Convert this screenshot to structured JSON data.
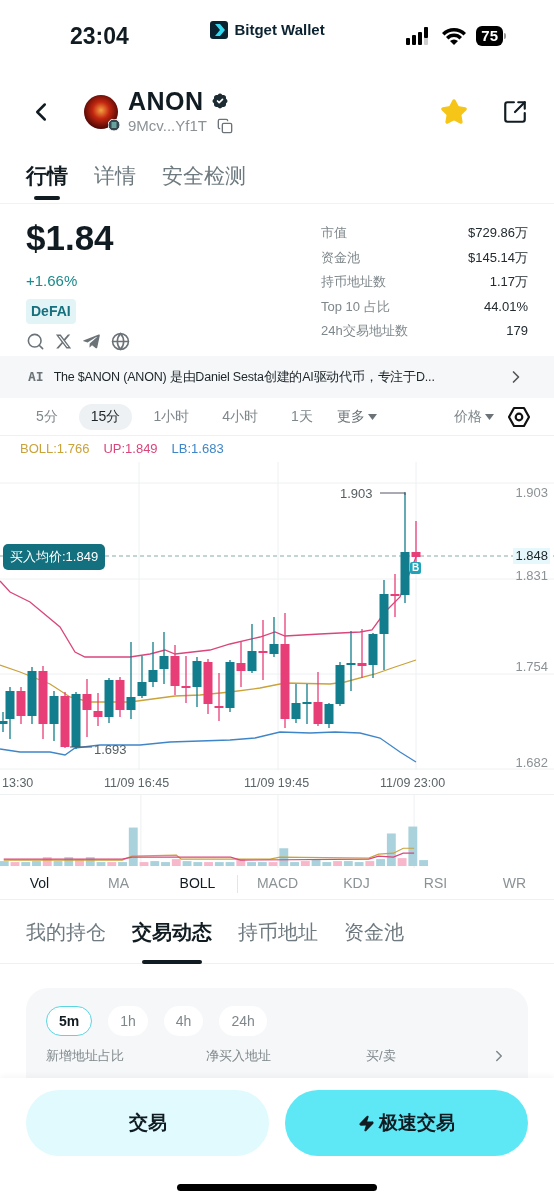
{
  "status_bar": {
    "time": "23:04",
    "app_name": "Bitget Wallet",
    "battery": "75"
  },
  "token": {
    "symbol": "ANON",
    "verified": true,
    "address": "9Mcv...Yf1T",
    "favorited": true
  },
  "page_tabs": [
    {
      "label": "行情",
      "selected": true
    },
    {
      "label": "详情",
      "selected": false
    },
    {
      "label": "安全检测",
      "selected": false
    }
  ],
  "price": {
    "value": "$1.84",
    "change": "+1.66%",
    "tag": "DeFAI"
  },
  "stats": [
    {
      "label": "市值",
      "value": "$729.86万"
    },
    {
      "label": "资金池",
      "value": "$145.14万"
    },
    {
      "label": "持币地址数",
      "value": "1.17万"
    },
    {
      "label": "Top 10 占比",
      "value": "44.01%"
    },
    {
      "label": "24h交易地址数",
      "value": "179"
    }
  ],
  "ai_summary": {
    "badge": "AI",
    "text": "The $ANON (ANON) 是由Daniel Sesta创建的AI驱动代币，专注于D..."
  },
  "intervals": [
    {
      "label": "5分",
      "selected": false
    },
    {
      "label": "15分",
      "selected": true
    },
    {
      "label": "1小时",
      "selected": false
    },
    {
      "label": "4小时",
      "selected": false
    },
    {
      "label": "1天",
      "selected": false
    }
  ],
  "more_menu": "更多",
  "price_menu": "价格",
  "chart": {
    "legend": [
      {
        "label": "BOLL:1.766",
        "color": "#c9a23a"
      },
      {
        "label": "UP:1.849",
        "color": "#d9467c"
      },
      {
        "label": "LB:1.683",
        "color": "#3f86c8"
      }
    ],
    "y_labels": [
      {
        "text": "1.903",
        "kind": "tick"
      },
      {
        "text": "1.848",
        "kind": "current"
      },
      {
        "text": "1.831",
        "kind": "tick"
      },
      {
        "text": "1.754",
        "kind": "tick"
      },
      {
        "text": "1.682",
        "kind": "tick"
      }
    ],
    "high_label": "1.903",
    "low_label": "1.693",
    "avg_price": "买入均价:1.849",
    "trade_marker": "B",
    "x_labels": [
      "13:30",
      "11/09 16:45",
      "11/09 19:45",
      "11/09 23:00"
    ]
  },
  "indicators": [
    {
      "label": "Vol",
      "selected": true
    },
    {
      "label": "MA",
      "selected": false
    },
    {
      "label": "BOLL",
      "selected": true
    },
    {
      "label": "MACD",
      "selected": false
    },
    {
      "label": "KDJ",
      "selected": false
    },
    {
      "label": "RSI",
      "selected": false
    },
    {
      "label": "WR",
      "selected": false
    }
  ],
  "section_tabs": [
    {
      "label": "我的持仓",
      "selected": false
    },
    {
      "label": "交易动态",
      "selected": true
    },
    {
      "label": "持币地址",
      "selected": false
    },
    {
      "label": "资金池",
      "selected": false
    }
  ],
  "activity": {
    "periods": [
      {
        "label": "5m",
        "selected": true
      },
      {
        "label": "1h",
        "selected": false
      },
      {
        "label": "4h",
        "selected": false
      },
      {
        "label": "24h",
        "selected": false
      }
    ],
    "columns": [
      "新增地址占比",
      "净买入地址",
      "买/卖"
    ]
  },
  "actions": {
    "trade": "交易",
    "quick_trade": "极速交易"
  }
}
